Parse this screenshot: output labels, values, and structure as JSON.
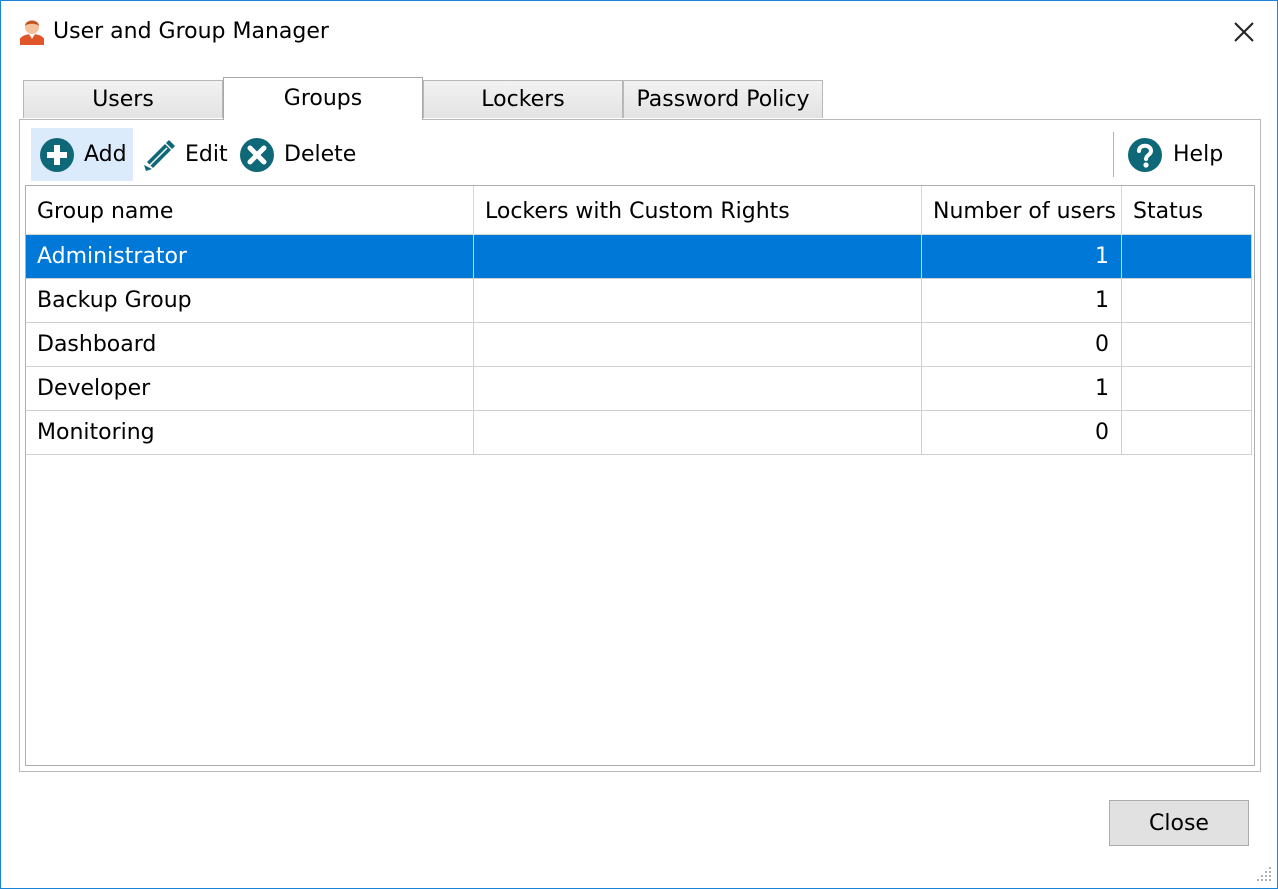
{
  "window": {
    "title": "User and Group Manager",
    "app_icon": "user-icon",
    "close_icon": "close-icon"
  },
  "tabs": [
    {
      "label": "Users",
      "active": false
    },
    {
      "label": "Groups",
      "active": true
    },
    {
      "label": "Lockers",
      "active": false
    },
    {
      "label": "Password Policy",
      "active": false
    }
  ],
  "toolbar": {
    "add_label": "Add",
    "add_icon": "plus-circle-icon",
    "edit_label": "Edit",
    "edit_icon": "pencil-icon",
    "delete_label": "Delete",
    "delete_icon": "x-circle-icon",
    "help_label": "Help",
    "help_icon": "question-circle-icon"
  },
  "table": {
    "columns": [
      "Group name",
      "Lockers with Custom Rights",
      "Number of users",
      "Status"
    ],
    "rows": [
      {
        "name": "Administrator",
        "lockers": "",
        "users": "1",
        "status": "",
        "selected": true
      },
      {
        "name": "Backup Group",
        "lockers": "",
        "users": "1",
        "status": "",
        "selected": false
      },
      {
        "name": "Dashboard",
        "lockers": "",
        "users": "0",
        "status": "",
        "selected": false
      },
      {
        "name": "Developer",
        "lockers": "",
        "users": "1",
        "status": "",
        "selected": false
      },
      {
        "name": "Monitoring",
        "lockers": "",
        "users": "0",
        "status": "",
        "selected": false
      }
    ]
  },
  "footer": {
    "close_label": "Close"
  },
  "colors": {
    "accent": "#0078d7",
    "icon_teal": "#0e6877",
    "window_border": "#1883d7",
    "hover": "#dcebfc"
  }
}
